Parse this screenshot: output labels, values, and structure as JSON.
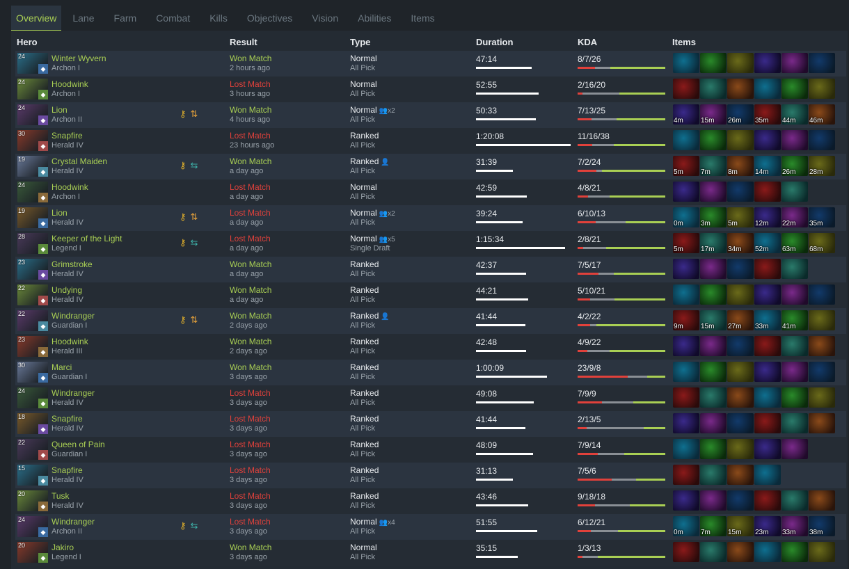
{
  "tabs": [
    "Overview",
    "Lane",
    "Farm",
    "Combat",
    "Kills",
    "Objectives",
    "Vision",
    "Abilities",
    "Items"
  ],
  "columns": {
    "hero": "Hero",
    "result": "Result",
    "type": "Type",
    "duration": "Duration",
    "kda": "KDA",
    "items": "Items"
  },
  "colors": {
    "accent": "#a9cf54",
    "won": "#a9cf54",
    "lost": "#e1413b"
  },
  "matches": [
    {
      "level": "24",
      "hero": "Winter Wyvern",
      "rank": "Archon I",
      "result": "Won Match",
      "outcome": "won",
      "time_ago": "2 hours ago",
      "type": "Normal",
      "party_size": "",
      "mode": "All Pick",
      "duration": "47:14",
      "duration_frac": 0.59,
      "kda": "8/7/26",
      "k": 8,
      "d": 7,
      "a": 26,
      "icons": [],
      "items": [
        {
          "t": ""
        },
        {
          "t": ""
        },
        {
          "t": ""
        },
        {
          "t": ""
        },
        {
          "t": ""
        },
        {
          "t": ""
        }
      ]
    },
    {
      "level": "24",
      "hero": "Hoodwink",
      "rank": "Archon I",
      "result": "Lost Match",
      "outcome": "lost",
      "time_ago": "3 hours ago",
      "type": "Normal",
      "party_size": "",
      "mode": "All Pick",
      "duration": "52:55",
      "duration_frac": 0.66,
      "kda": "2/16/20",
      "k": 2,
      "d": 16,
      "a": 20,
      "icons": [],
      "items": [
        {
          "t": ""
        },
        {
          "t": ""
        },
        {
          "t": ""
        },
        {
          "t": ""
        },
        {
          "t": ""
        },
        {
          "t": ""
        }
      ]
    },
    {
      "level": "24",
      "hero": "Lion",
      "rank": "Archon II",
      "result": "Won Match",
      "outcome": "won",
      "time_ago": "4 hours ago",
      "type": "Normal",
      "party_size": "x2",
      "mode": "All Pick",
      "duration": "50:33",
      "duration_frac": 0.63,
      "kda": "7/13/25",
      "k": 7,
      "d": 13,
      "a": 25,
      "icons": [
        "key",
        "updown"
      ],
      "items": [
        {
          "t": "4m"
        },
        {
          "t": "15m"
        },
        {
          "t": "26m"
        },
        {
          "t": "35m"
        },
        {
          "t": "44m"
        },
        {
          "t": "46m"
        }
      ]
    },
    {
      "level": "30",
      "hero": "Snapfire",
      "rank": "Herald IV",
      "result": "Lost Match",
      "outcome": "lost",
      "time_ago": "23 hours ago",
      "type": "Ranked",
      "party_size": "",
      "mode": "All Pick",
      "duration": "1:20:08",
      "duration_frac": 1.0,
      "kda": "11/16/38",
      "k": 11,
      "d": 16,
      "a": 38,
      "icons": [],
      "items": [
        {
          "t": ""
        },
        {
          "t": ""
        },
        {
          "t": ""
        },
        {
          "t": ""
        },
        {
          "t": ""
        },
        {
          "t": ""
        }
      ]
    },
    {
      "level": "19",
      "hero": "Crystal Maiden",
      "rank": "Herald IV",
      "result": "Won Match",
      "outcome": "won",
      "time_ago": "a day ago",
      "type": "Ranked",
      "party_size": "solo",
      "mode": "All Pick",
      "duration": "31:39",
      "duration_frac": 0.39,
      "kda": "7/2/24",
      "k": 7,
      "d": 2,
      "a": 24,
      "icons": [
        "key",
        "swap"
      ],
      "items": [
        {
          "t": "5m"
        },
        {
          "t": "7m"
        },
        {
          "t": "8m"
        },
        {
          "t": "14m"
        },
        {
          "t": "26m"
        },
        {
          "t": "28m"
        }
      ]
    },
    {
      "level": "24",
      "hero": "Hoodwink",
      "rank": "Archon I",
      "result": "Lost Match",
      "outcome": "lost",
      "time_ago": "a day ago",
      "type": "Normal",
      "party_size": "",
      "mode": "All Pick",
      "duration": "42:59",
      "duration_frac": 0.54,
      "kda": "4/8/21",
      "k": 4,
      "d": 8,
      "a": 21,
      "icons": [],
      "items": [
        {
          "t": ""
        },
        {
          "t": ""
        },
        {
          "t": ""
        },
        {
          "t": ""
        },
        {
          "t": ""
        }
      ]
    },
    {
      "level": "19",
      "hero": "Lion",
      "rank": "Herald IV",
      "result": "Lost Match",
      "outcome": "lost",
      "time_ago": "a day ago",
      "type": "Normal",
      "party_size": "x2",
      "mode": "All Pick",
      "duration": "39:24",
      "duration_frac": 0.49,
      "kda": "6/10/13",
      "k": 6,
      "d": 10,
      "a": 13,
      "icons": [
        "key",
        "updown"
      ],
      "items": [
        {
          "t": "0m"
        },
        {
          "t": "3m"
        },
        {
          "t": "5m"
        },
        {
          "t": "12m"
        },
        {
          "t": "22m"
        },
        {
          "t": "35m"
        }
      ]
    },
    {
      "level": "28",
      "hero": "Keeper of the Light",
      "rank": "Legend I",
      "result": "Lost Match",
      "outcome": "lost",
      "time_ago": "a day ago",
      "type": "Normal",
      "party_size": "x5",
      "mode": "Single Draft",
      "duration": "1:15:34",
      "duration_frac": 0.94,
      "kda": "2/8/21",
      "k": 2,
      "d": 8,
      "a": 21,
      "icons": [
        "key",
        "swap"
      ],
      "items": [
        {
          "t": "5m"
        },
        {
          "t": "17m"
        },
        {
          "t": "34m"
        },
        {
          "t": "52m"
        },
        {
          "t": "63m"
        },
        {
          "t": "68m"
        }
      ]
    },
    {
      "level": "23",
      "hero": "Grimstroke",
      "rank": "Herald IV",
      "result": "Won Match",
      "outcome": "won",
      "time_ago": "a day ago",
      "type": "Ranked",
      "party_size": "",
      "mode": "All Pick",
      "duration": "42:37",
      "duration_frac": 0.53,
      "kda": "7/5/17",
      "k": 7,
      "d": 5,
      "a": 17,
      "icons": [],
      "items": [
        {
          "t": ""
        },
        {
          "t": ""
        },
        {
          "t": ""
        },
        {
          "t": ""
        },
        {
          "t": ""
        }
      ]
    },
    {
      "level": "22",
      "hero": "Undying",
      "rank": "Herald IV",
      "result": "Won Match",
      "outcome": "won",
      "time_ago": "a day ago",
      "type": "Ranked",
      "party_size": "",
      "mode": "All Pick",
      "duration": "44:21",
      "duration_frac": 0.55,
      "kda": "5/10/21",
      "k": 5,
      "d": 10,
      "a": 21,
      "icons": [],
      "items": [
        {
          "t": ""
        },
        {
          "t": ""
        },
        {
          "t": ""
        },
        {
          "t": ""
        },
        {
          "t": ""
        },
        {
          "t": ""
        }
      ]
    },
    {
      "level": "22",
      "hero": "Windranger",
      "rank": "Guardian I",
      "result": "Won Match",
      "outcome": "won",
      "time_ago": "2 days ago",
      "type": "Ranked",
      "party_size": "solo",
      "mode": "All Pick",
      "duration": "41:44",
      "duration_frac": 0.52,
      "kda": "4/2/22",
      "k": 4,
      "d": 2,
      "a": 22,
      "icons": [
        "key",
        "updown"
      ],
      "items": [
        {
          "t": "9m"
        },
        {
          "t": "15m"
        },
        {
          "t": "27m"
        },
        {
          "t": "33m"
        },
        {
          "t": "41m"
        },
        {
          "t": ""
        }
      ]
    },
    {
      "level": "23",
      "hero": "Hoodwink",
      "rank": "Herald III",
      "result": "Won Match",
      "outcome": "won",
      "time_ago": "2 days ago",
      "type": "Ranked",
      "party_size": "",
      "mode": "All Pick",
      "duration": "42:48",
      "duration_frac": 0.53,
      "kda": "4/9/22",
      "k": 4,
      "d": 9,
      "a": 22,
      "icons": [],
      "items": [
        {
          "t": ""
        },
        {
          "t": ""
        },
        {
          "t": ""
        },
        {
          "t": ""
        },
        {
          "t": ""
        },
        {
          "t": ""
        }
      ]
    },
    {
      "level": "30",
      "hero": "Marci",
      "rank": "Guardian I",
      "result": "Won Match",
      "outcome": "won",
      "time_ago": "3 days ago",
      "type": "Ranked",
      "party_size": "",
      "mode": "All Pick",
      "duration": "1:00:09",
      "duration_frac": 0.75,
      "kda": "23/9/8",
      "k": 23,
      "d": 9,
      "a": 8,
      "icons": [],
      "items": [
        {
          "t": ""
        },
        {
          "t": ""
        },
        {
          "t": ""
        },
        {
          "t": ""
        },
        {
          "t": ""
        },
        {
          "t": ""
        }
      ]
    },
    {
      "level": "24",
      "hero": "Windranger",
      "rank": "Herald IV",
      "result": "Lost Match",
      "outcome": "lost",
      "time_ago": "3 days ago",
      "type": "Ranked",
      "party_size": "",
      "mode": "All Pick",
      "duration": "49:08",
      "duration_frac": 0.61,
      "kda": "7/9/9",
      "k": 7,
      "d": 9,
      "a": 9,
      "icons": [],
      "items": [
        {
          "t": ""
        },
        {
          "t": ""
        },
        {
          "t": ""
        },
        {
          "t": ""
        },
        {
          "t": ""
        },
        {
          "t": ""
        }
      ]
    },
    {
      "level": "18",
      "hero": "Snapfire",
      "rank": "Herald IV",
      "result": "Lost Match",
      "outcome": "lost",
      "time_ago": "3 days ago",
      "type": "Ranked",
      "party_size": "",
      "mode": "All Pick",
      "duration": "41:44",
      "duration_frac": 0.52,
      "kda": "2/13/5",
      "k": 2,
      "d": 13,
      "a": 5,
      "icons": [],
      "items": [
        {
          "t": ""
        },
        {
          "t": ""
        },
        {
          "t": ""
        },
        {
          "t": ""
        },
        {
          "t": ""
        },
        {
          "t": ""
        }
      ]
    },
    {
      "level": "22",
      "hero": "Queen of Pain",
      "rank": "Guardian I",
      "result": "Lost Match",
      "outcome": "lost",
      "time_ago": "3 days ago",
      "type": "Ranked",
      "party_size": "",
      "mode": "All Pick",
      "duration": "48:09",
      "duration_frac": 0.6,
      "kda": "7/9/14",
      "k": 7,
      "d": 9,
      "a": 14,
      "icons": [],
      "items": [
        {
          "t": ""
        },
        {
          "t": ""
        },
        {
          "t": ""
        },
        {
          "t": ""
        },
        {
          "t": ""
        }
      ]
    },
    {
      "level": "15",
      "hero": "Snapfire",
      "rank": "Herald IV",
      "result": "Lost Match",
      "outcome": "lost",
      "time_ago": "3 days ago",
      "type": "Ranked",
      "party_size": "",
      "mode": "All Pick",
      "duration": "31:13",
      "duration_frac": 0.39,
      "kda": "7/5/6",
      "k": 7,
      "d": 5,
      "a": 6,
      "icons": [],
      "items": [
        {
          "t": ""
        },
        {
          "t": ""
        },
        {
          "t": ""
        },
        {
          "t": ""
        }
      ]
    },
    {
      "level": "20",
      "hero": "Tusk",
      "rank": "Herald IV",
      "result": "Lost Match",
      "outcome": "lost",
      "time_ago": "3 days ago",
      "type": "Ranked",
      "party_size": "",
      "mode": "All Pick",
      "duration": "43:46",
      "duration_frac": 0.55,
      "kda": "9/18/18",
      "k": 9,
      "d": 18,
      "a": 18,
      "icons": [],
      "items": [
        {
          "t": ""
        },
        {
          "t": ""
        },
        {
          "t": ""
        },
        {
          "t": ""
        },
        {
          "t": ""
        },
        {
          "t": ""
        }
      ]
    },
    {
      "level": "24",
      "hero": "Windranger",
      "rank": "Archon II",
      "result": "Lost Match",
      "outcome": "lost",
      "time_ago": "3 days ago",
      "type": "Normal",
      "party_size": "x4",
      "mode": "All Pick",
      "duration": "51:55",
      "duration_frac": 0.65,
      "kda": "6/12/21",
      "k": 6,
      "d": 12,
      "a": 21,
      "icons": [
        "key",
        "swap"
      ],
      "items": [
        {
          "t": "0m"
        },
        {
          "t": "7m"
        },
        {
          "t": "15m"
        },
        {
          "t": "23m"
        },
        {
          "t": "33m"
        },
        {
          "t": "38m"
        }
      ]
    },
    {
      "level": "20",
      "hero": "Jakiro",
      "rank": "Legend I",
      "result": "Won Match",
      "outcome": "won",
      "time_ago": "3 days ago",
      "type": "Normal",
      "party_size": "",
      "mode": "All Pick",
      "duration": "35:15",
      "duration_frac": 0.44,
      "kda": "1/3/13",
      "k": 1,
      "d": 3,
      "a": 13,
      "icons": [],
      "items": [
        {
          "t": ""
        },
        {
          "t": ""
        },
        {
          "t": ""
        },
        {
          "t": ""
        },
        {
          "t": ""
        },
        {
          "t": ""
        }
      ]
    }
  ]
}
